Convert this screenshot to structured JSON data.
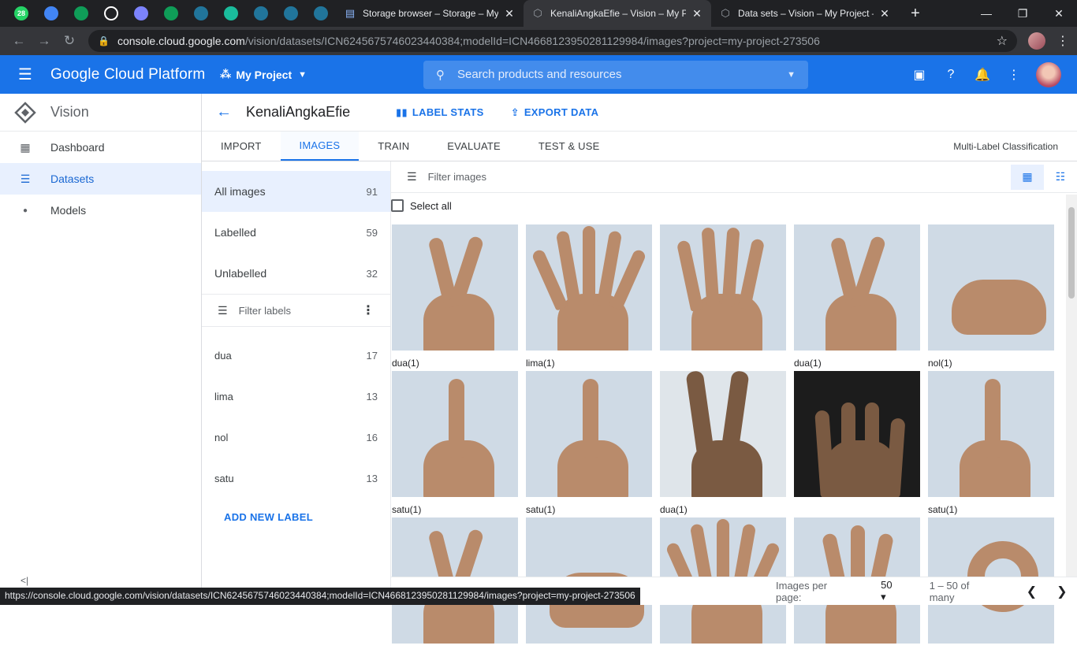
{
  "browser": {
    "pinned_tabs": [
      {
        "icon": "whatsapp-icon",
        "badge": "28",
        "color": "#25d366"
      },
      {
        "icon": "card-icon",
        "color": "#4285f4"
      },
      {
        "icon": "classroom-icon",
        "color": "#0f9d58"
      },
      {
        "icon": "github-icon",
        "color": "#ffffff"
      },
      {
        "icon": "app-icon",
        "color": "#7c83fd"
      },
      {
        "icon": "classroom-icon",
        "color": "#0f9d58"
      },
      {
        "icon": "wordpress-icon",
        "color": "#21759b"
      },
      {
        "icon": "feather-icon",
        "color": "#1abc9c"
      },
      {
        "icon": "wordpress-icon",
        "color": "#21759b"
      },
      {
        "icon": "wordpress-icon",
        "color": "#21759b"
      },
      {
        "icon": "wordpress-icon",
        "color": "#21759b"
      }
    ],
    "tabs": [
      {
        "title": "Storage browser – Storage – My Project",
        "active": false
      },
      {
        "title": "KenaliAngkaEfie – Vision – My Project",
        "active": true
      },
      {
        "title": "Data sets – Vision – My Project – ",
        "active": false
      }
    ],
    "url_host": "console.cloud.google.com",
    "url_path": "/vision/datasets/ICN6245675746023440384;modelId=ICN4668123950281129984/images?project=my-project-273506",
    "status_url": "https://console.cloud.google.com/vision/datasets/ICN6245675746023440384;modelId=ICN4668123950281129984/images?project=my-project-273506"
  },
  "header": {
    "brand": "Google Cloud Platform",
    "project": "My Project",
    "search_placeholder": "Search products and resources",
    "accent": "#1a73e8"
  },
  "leftnav": {
    "product": "Vision",
    "items": [
      {
        "label": "Dashboard",
        "icon": "dashboard-icon",
        "selected": false
      },
      {
        "label": "Datasets",
        "icon": "list-icon",
        "selected": true
      },
      {
        "label": "Models",
        "icon": "lightbulb-icon",
        "selected": false
      }
    ]
  },
  "main": {
    "dataset_title": "KenaliAngkaEfie",
    "label_stats": "LABEL STATS",
    "export_data": "EXPORT DATA",
    "tabs": [
      "IMPORT",
      "IMAGES",
      "TRAIN",
      "EVALUATE",
      "TEST & USE"
    ],
    "active_tab": "IMAGES",
    "classification_type": "Multi-Label Classification"
  },
  "filters": {
    "rows": [
      {
        "label": "All images",
        "count": "91",
        "active": true
      },
      {
        "label": "Labelled",
        "count": "59",
        "active": false
      },
      {
        "label": "Unlabelled",
        "count": "32",
        "active": false
      }
    ],
    "label_filter_placeholder": "Filter labels",
    "labels": [
      {
        "label": "dua",
        "count": "17"
      },
      {
        "label": "lima",
        "count": "13"
      },
      {
        "label": "nol",
        "count": "16"
      },
      {
        "label": "satu",
        "count": "13"
      }
    ],
    "add_label": "ADD NEW LABEL"
  },
  "images": {
    "filter_placeholder": "Filter images",
    "select_all": "Select all",
    "items": [
      {
        "caption": "dua(1)",
        "gesture": "two"
      },
      {
        "caption": "lima(1)",
        "gesture": "five"
      },
      {
        "caption": "",
        "gesture": "four"
      },
      {
        "caption": "dua(1)",
        "gesture": "two"
      },
      {
        "caption": "nol(1)",
        "gesture": "fist"
      },
      {
        "caption": "satu(1)",
        "gesture": "one"
      },
      {
        "caption": "satu(1)",
        "gesture": "one"
      },
      {
        "caption": "dua(1)",
        "gesture": "two-dark"
      },
      {
        "caption": "",
        "gesture": "four-dark"
      },
      {
        "caption": "satu(1)",
        "gesture": "one"
      },
      {
        "caption": "",
        "gesture": "two"
      },
      {
        "caption": "",
        "gesture": "fist"
      },
      {
        "caption": "",
        "gesture": "five"
      },
      {
        "caption": "",
        "gesture": "three"
      },
      {
        "caption": "",
        "gesture": "zero"
      }
    ]
  },
  "pagination": {
    "per_page_label": "Images per page:",
    "per_page": "50",
    "range": "1 – 50 of many"
  }
}
